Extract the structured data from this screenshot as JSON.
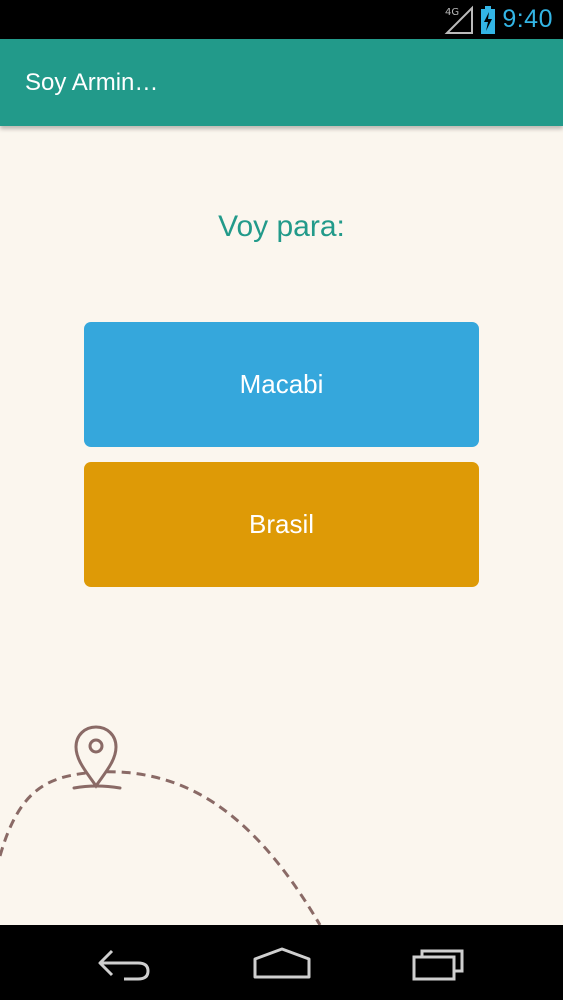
{
  "status_bar": {
    "network": "4G",
    "time": "9:40"
  },
  "app_bar": {
    "title": "Soy Armin…"
  },
  "main": {
    "heading": "Voy para:",
    "options": [
      {
        "label": "Macabi",
        "color": "#35a7dc"
      },
      {
        "label": "Brasil",
        "color": "#de9a06"
      }
    ]
  },
  "nav_bar": {
    "icons": [
      "back-icon",
      "home-icon",
      "recent-apps-icon"
    ]
  },
  "colors": {
    "accent": "#229a8a",
    "background": "#fbf6ee",
    "status_icons": "#33b5e5",
    "decoration": "#8a6a66"
  }
}
